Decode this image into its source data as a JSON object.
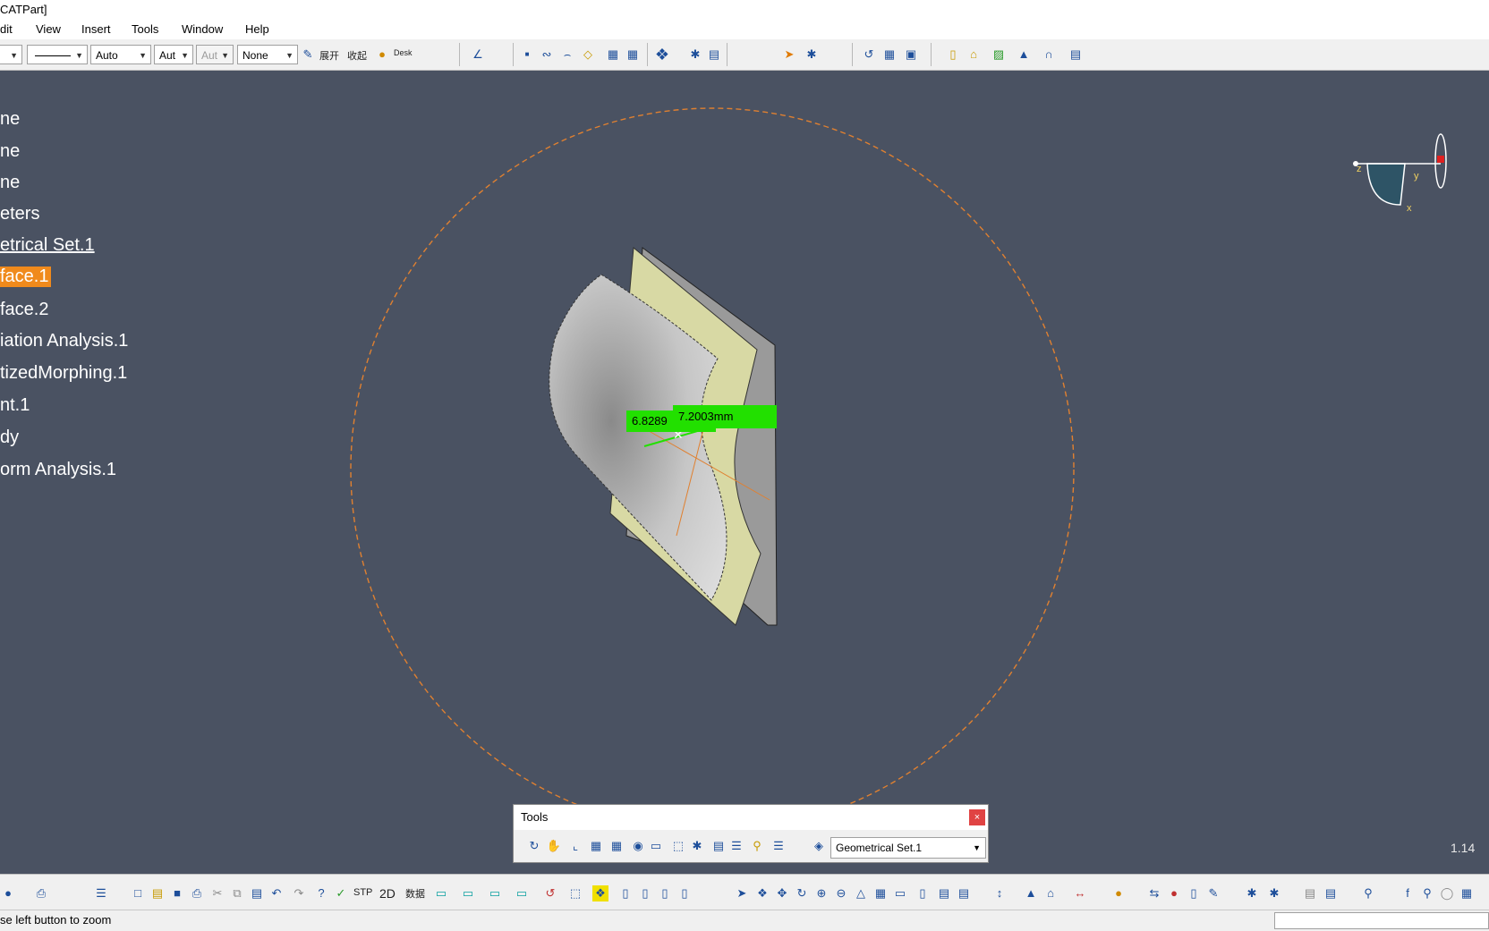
{
  "title_text": "CATPart]",
  "menu": {
    "edit": "dit",
    "view": "View",
    "insert": "Insert",
    "tools": "Tools",
    "window": "Window",
    "help": "Help"
  },
  "toolbar": {
    "line_weight_value": "Auto",
    "line_type_value": "Aut",
    "layer_disabled_value": "Aut",
    "layer_value": "None",
    "expand_label": "展开",
    "collapse_label": "收起",
    "desk_label": "Desk"
  },
  "tree": {
    "items": [
      {
        "label": "ne",
        "underlined": false,
        "selected": false
      },
      {
        "label": "ne",
        "underlined": false,
        "selected": false
      },
      {
        "label": "ne",
        "underlined": false,
        "selected": false
      },
      {
        "label": "eters",
        "underlined": false,
        "selected": false
      },
      {
        "label": "etrical Set.1",
        "underlined": true,
        "selected": false
      },
      {
        "label": "face.1",
        "underlined": false,
        "selected": true
      },
      {
        "label": "face.2",
        "underlined": false,
        "selected": false
      },
      {
        "label": "iation Analysis.1",
        "underlined": false,
        "selected": false
      },
      {
        "label": "tizedMorphing.1",
        "underlined": false,
        "selected": false
      },
      {
        "label": "nt.1",
        "underlined": false,
        "selected": false
      },
      {
        "label": "dy",
        "underlined": false,
        "selected": false
      },
      {
        "label": "orm Analysis.1",
        "underlined": false,
        "selected": false
      }
    ]
  },
  "viewport": {
    "measure_label_1": "6.8289",
    "measure_label_2": "7.2003mm",
    "compass": {
      "x_label": "x",
      "y_label": "y",
      "z_label": "z"
    },
    "zoom_readout": "1.14"
  },
  "tools_panel": {
    "title": "Tools",
    "close_label": "×",
    "current_set": "Geometrical Set.1"
  },
  "bottom_toolbar": {
    "stp_label": "STP",
    "mode_2d_label": "2D",
    "data_label": "数据"
  },
  "status": {
    "message": "se left button to zoom"
  },
  "colors": {
    "viewport_bg": "#4a5262",
    "selection": "#f08a1c",
    "measure_green": "#22e000",
    "dashed_circle": "#e08030"
  }
}
